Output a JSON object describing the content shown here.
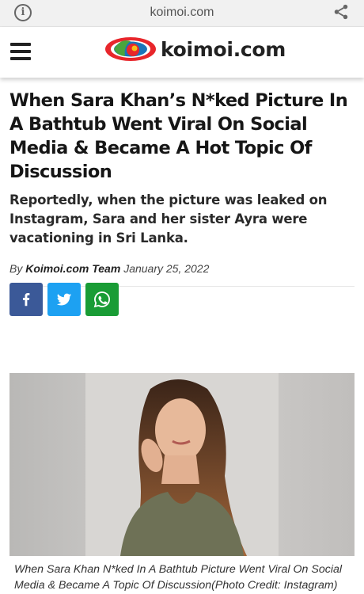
{
  "browser": {
    "url": "koimoi.com",
    "info_icon_glyph": "i",
    "info_icon": "info-icon",
    "share_icon": "share-icon"
  },
  "site": {
    "logo_text": "koimoi.com",
    "menu_icon": "hamburger-menu-icon"
  },
  "article": {
    "headline": "When Sara Khan’s N*ked Picture In A Bathtub Went Viral On Social Media & Became A Hot Topic Of Discussion",
    "subheadline": "Reportedly, when the picture was leaked on Instagram, Sara and her sister Ayra were vacationing in Sri Lanka.",
    "byline_prefix": "By",
    "author": "Koimoi.com Team",
    "date": "January 25, 2022",
    "image_caption": "When Sara Khan N*ked In A Bathtub Picture Went Viral On Social Media & Became A Topic Of Discussion(Photo Credit: Instagram)"
  },
  "share_buttons": [
    {
      "name": "facebook",
      "icon": "facebook-icon",
      "color": "#3b5998"
    },
    {
      "name": "twitter",
      "icon": "twitter-icon",
      "color": "#1da1f2"
    },
    {
      "name": "whatsapp",
      "icon": "whatsapp-icon",
      "color": "#199c35"
    }
  ],
  "colors": {
    "logo_red": "#e8262b",
    "logo_blue": "#1a74b9",
    "logo_green": "#4aa53d",
    "logo_yellow": "#f6c01a"
  }
}
